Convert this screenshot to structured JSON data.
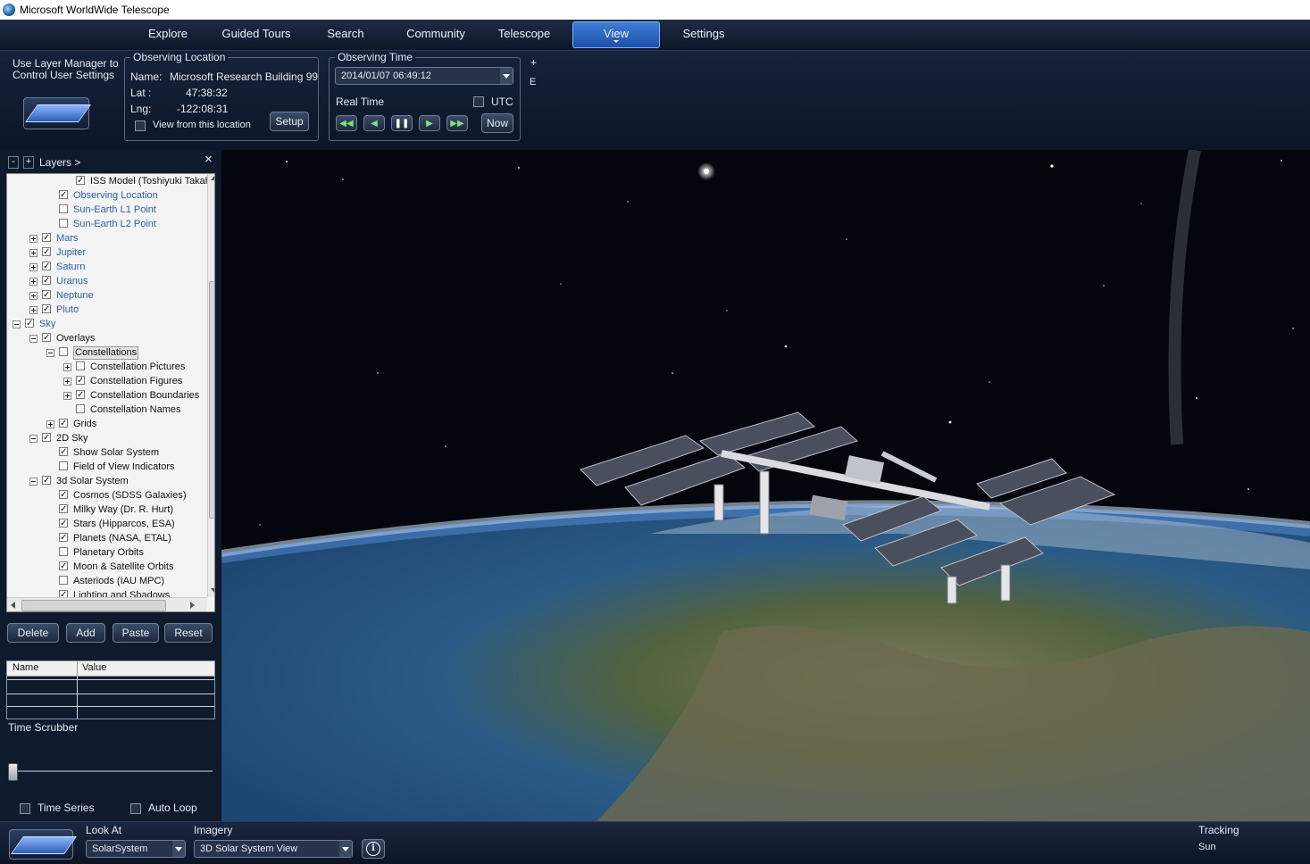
{
  "window": {
    "title": "Microsoft WorldWide Telescope"
  },
  "menu": {
    "items": [
      "Explore",
      "Guided Tours",
      "Search",
      "Community",
      "Telescope",
      "View",
      "Settings"
    ],
    "active": "View"
  },
  "top_panel": {
    "layer_manager_hint": "Use Layer Manager to Control User Settings",
    "observing_location": {
      "title": "Observing Location",
      "name_label": "Name:",
      "name_value": "Microsoft Research Building 99",
      "lat_label": "Lat :",
      "lat_value": "47:38:32",
      "lng_label": "Lng:",
      "lng_value": "-122:08:31",
      "view_from_label": "View from this location",
      "setup_button": "Setup"
    },
    "observing_time": {
      "title": "Observing Time",
      "datetime": "2014/01/07   06:49:12",
      "real_time_label": "Real Time",
      "utc_label": "UTC",
      "now_button": "Now"
    },
    "side_plus": "+",
    "side_e": "E"
  },
  "layers": {
    "header_minus": "-",
    "header_plus": "+",
    "header_label": "Layers  >",
    "close": "×",
    "rows": [
      {
        "text": "ISS Model  (Toshiyuki Takahei)",
        "checked": true,
        "blue": false,
        "expander": "",
        "level": 4
      },
      {
        "text": "Observing Location",
        "checked": true,
        "blue": true,
        "expander": "",
        "level": 3
      },
      {
        "text": "Sun-Earth L1 Point",
        "checked": false,
        "blue": true,
        "expander": "",
        "level": 3
      },
      {
        "text": "Sun-Earth L2 Point",
        "checked": false,
        "blue": true,
        "expander": "",
        "level": 3
      },
      {
        "text": "Mars",
        "checked": true,
        "blue": true,
        "expander": "plus",
        "level": 2
      },
      {
        "text": "Jupiter",
        "checked": true,
        "blue": true,
        "expander": "plus",
        "level": 2
      },
      {
        "text": "Saturn",
        "checked": true,
        "blue": true,
        "expander": "plus",
        "level": 2
      },
      {
        "text": "Uranus",
        "checked": true,
        "blue": true,
        "expander": "plus",
        "level": 2
      },
      {
        "text": "Neptune",
        "checked": true,
        "blue": true,
        "expander": "plus",
        "level": 2
      },
      {
        "text": "Pluto",
        "checked": true,
        "blue": true,
        "expander": "plus",
        "level": 2
      },
      {
        "text": "Sky",
        "checked": true,
        "blue": true,
        "expander": "minus",
        "level": 1
      },
      {
        "text": "Overlays",
        "checked": true,
        "blue": false,
        "expander": "minus",
        "level": 2
      },
      {
        "text": "Constellations",
        "checked": false,
        "blue": false,
        "expander": "minus",
        "level": 3,
        "selected": true
      },
      {
        "text": "Constellation Pictures",
        "checked": false,
        "blue": false,
        "expander": "plus",
        "level": 4
      },
      {
        "text": "Constellation Figures",
        "checked": true,
        "blue": false,
        "expander": "plus",
        "level": 4
      },
      {
        "text": "Constellation Boundaries",
        "checked": true,
        "blue": false,
        "expander": "plus",
        "level": 4
      },
      {
        "text": "Constellation Names",
        "checked": false,
        "blue": false,
        "expander": "",
        "level": 4
      },
      {
        "text": "Grids",
        "checked": true,
        "blue": false,
        "expander": "plus",
        "level": 3
      },
      {
        "text": "2D Sky",
        "checked": true,
        "blue": false,
        "expander": "minus",
        "level": 2
      },
      {
        "text": "Show Solar System",
        "checked": true,
        "blue": false,
        "expander": "",
        "level": 3
      },
      {
        "text": "Field of View Indicators",
        "checked": false,
        "blue": false,
        "expander": "",
        "level": 3
      },
      {
        "text": "3d Solar System",
        "checked": true,
        "blue": false,
        "expander": "minus",
        "level": 2
      },
      {
        "text": "Cosmos (SDSS Galaxies)",
        "checked": true,
        "blue": false,
        "expander": "",
        "level": 3
      },
      {
        "text": "Milky Way (Dr. R. Hurt)",
        "checked": true,
        "blue": false,
        "expander": "",
        "level": 3
      },
      {
        "text": "Stars (Hipparcos, ESA)",
        "checked": true,
        "blue": false,
        "expander": "",
        "level": 3
      },
      {
        "text": "Planets (NASA, ETAL)",
        "checked": true,
        "blue": false,
        "expander": "",
        "level": 3
      },
      {
        "text": "Planetary Orbits",
        "checked": false,
        "blue": false,
        "expander": "",
        "level": 3
      },
      {
        "text": "Moon & Satellite Orbits",
        "checked": true,
        "blue": false,
        "expander": "",
        "level": 3
      },
      {
        "text": "Asteriods (IAU MPC)",
        "checked": false,
        "blue": false,
        "expander": "",
        "level": 3
      },
      {
        "text": "Lighting and Shadows",
        "checked": true,
        "blue": false,
        "expander": "",
        "level": 3
      }
    ],
    "buttons": [
      "Delete",
      "Add",
      "Paste",
      "Reset"
    ],
    "props_headers": [
      "Name",
      "Value"
    ],
    "time_scrubber_label": "Time Scrubber",
    "time_series_label": "Time Series",
    "auto_loop_label": "Auto Loop"
  },
  "bottom_bar": {
    "look_at_label": "Look At",
    "look_at_value": "SolarSystem",
    "imagery_label": "Imagery",
    "imagery_value": "3D Solar System View",
    "info_icon": "i",
    "tracking_label": "Tracking",
    "tracking_value": "Sun"
  },
  "colors": {
    "accent": "#3f7fd8",
    "tree_link": "#2d5db8"
  }
}
